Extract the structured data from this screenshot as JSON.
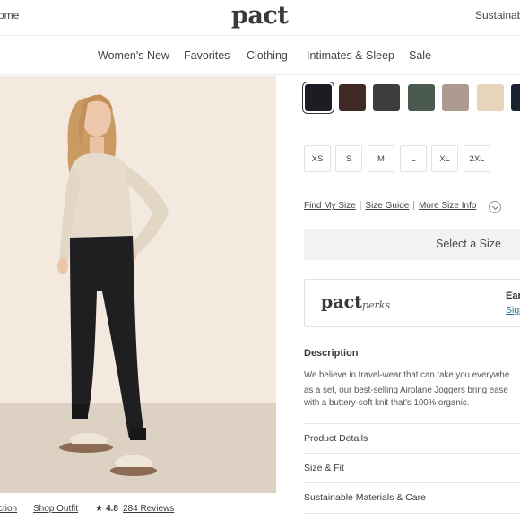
{
  "header": {
    "left_link": "ome",
    "logo": "pact",
    "right_link": "Sustainab"
  },
  "nav": {
    "items": [
      "Women's New",
      "Favorites",
      "Clothing",
      "Intimates & Sleep",
      "Sale"
    ]
  },
  "product_image": {
    "alt": "Model wearing a beige sweater and black joggers"
  },
  "below_image": {
    "section_link": "ction",
    "shop_outfit": "Shop Outfit",
    "star_icon": "star-icon",
    "rating": "4.8",
    "reviews": "284 Reviews"
  },
  "colors": {
    "swatches": [
      {
        "name": "black",
        "hex": "#1c1d24",
        "selected": true
      },
      {
        "name": "dark-brown",
        "hex": "#3f2a26"
      },
      {
        "name": "charcoal",
        "hex": "#3b3d3f"
      },
      {
        "name": "forest-green",
        "hex": "#4b5a4e"
      },
      {
        "name": "taupe",
        "hex": "#ad9a90"
      },
      {
        "name": "oatmeal",
        "hex": "#e6d4bb"
      },
      {
        "name": "navy",
        "hex": "#1d2230"
      }
    ]
  },
  "sizes": [
    "XS",
    "S",
    "M",
    "L",
    "XL",
    "2XL"
  ],
  "size_links": {
    "find_my_size": "Find My Size",
    "size_guide": "Size Guide",
    "more_size_info": "More Size Info",
    "separator": "|"
  },
  "select_size_button": "Select a Size",
  "perks": {
    "logo": "pact",
    "logo_suffix": "perks",
    "earn": "Ear",
    "sign_in": "Sign"
  },
  "description": {
    "heading": "Description",
    "lines": [
      "We believe in travel-wear that can take you everywhe",
      "as a set, our best-selling Airplane Joggers bring ease",
      "with a buttery-soft knit that's 100% organic."
    ]
  },
  "accordion": [
    "Product Details",
    "Size & Fit",
    "Sustainable Materials & Care"
  ]
}
